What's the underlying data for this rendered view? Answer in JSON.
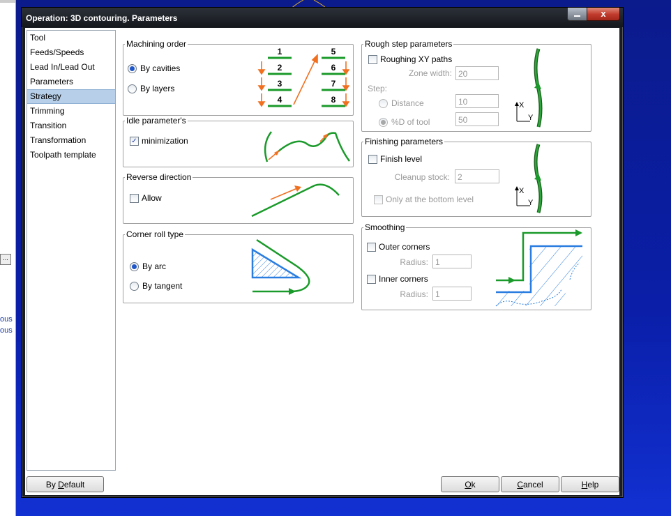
{
  "window": {
    "title": "Operation: 3D contouring. Parameters",
    "close_glyph": "x"
  },
  "background": {
    "snippet1": "ous",
    "snippet2": "ous",
    "button": "..."
  },
  "sidebar": {
    "items": [
      {
        "label": "Tool"
      },
      {
        "label": "Feeds/Speeds"
      },
      {
        "label": "Lead In/Lead Out"
      },
      {
        "label": "Parameters"
      },
      {
        "label": "Strategy",
        "selected": true
      },
      {
        "label": "Trimming"
      },
      {
        "label": "Transition"
      },
      {
        "label": "Transformation"
      },
      {
        "label": "Toolpath template"
      }
    ]
  },
  "machining_order": {
    "title": "Machining order",
    "by_cavities": "By cavities",
    "by_layers": "By layers",
    "selected": "By cavities",
    "diagram_numbers": [
      "1",
      "2",
      "3",
      "4",
      "5",
      "6",
      "7",
      "8"
    ]
  },
  "idle": {
    "title": "Idle parameter's",
    "minimization": "minimization",
    "minimization_checked": true
  },
  "reverse": {
    "title": "Reverse direction",
    "allow": "Allow",
    "allow_checked": false
  },
  "corner": {
    "title": "Corner roll type",
    "by_arc": "By arc",
    "by_tangent": "By tangent",
    "selected": "By arc"
  },
  "rough": {
    "title": "Rough step parameters",
    "roughing_xy": "Roughing XY paths",
    "roughing_xy_checked": false,
    "zone_width_label": "Zone width:",
    "zone_width": "20",
    "step_label": "Step:",
    "distance_label": "Distance",
    "distance_value": "10",
    "pct_label": "%D of tool",
    "pct_value": "50",
    "axis_x": "X",
    "axis_y": "Y"
  },
  "finishing": {
    "title": "Finishing parameters",
    "finish_level": "Finish level",
    "finish_level_checked": false,
    "cleanup_label": "Cleanup stock:",
    "cleanup_value": "2",
    "only_bottom": "Only at the bottom level",
    "axis_x": "X",
    "axis_y": "Y"
  },
  "smoothing": {
    "title": "Smoothing",
    "outer": "Outer corners",
    "outer_radius_label": "Radius:",
    "outer_radius": "1",
    "inner": "Inner corners",
    "inner_radius_label": "Radius:",
    "inner_radius": "1"
  },
  "buttons": {
    "default_pre": "By ",
    "default_u": "D",
    "default_post": "efault",
    "ok_u": "O",
    "ok_post": "k",
    "cancel_u": "C",
    "cancel_post": "ancel",
    "help_u": "H",
    "help_post": "elp"
  },
  "colors": {
    "path_green": "#1a9a2a",
    "arrow_orange": "#f07020",
    "hatch_blue": "#2a7de0",
    "selection": "#b7cfe8"
  }
}
